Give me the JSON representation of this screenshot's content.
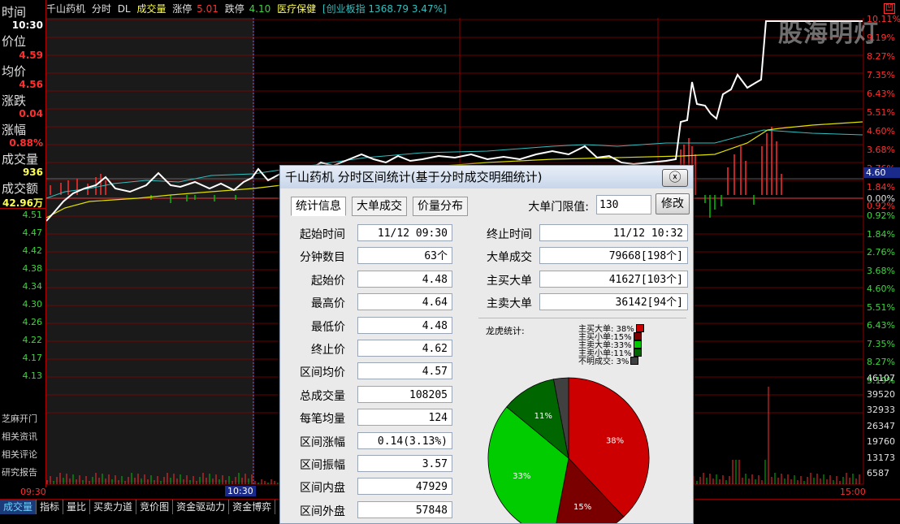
{
  "header": {
    "name": "千山药机",
    "mode": "分时",
    "dl": "DL",
    "vol": "成交量",
    "zt_label": "涨停",
    "zt_val": "5.01",
    "dt_label": "跌停",
    "dt_val": "4.10",
    "sector": "医疗保健",
    "index": "[创业板指 1368.79 3.47%]"
  },
  "watermark": "股海明灯",
  "corner_mark": "凹",
  "left_info": {
    "time_label": "时间",
    "time": "10:30",
    "price_label": "价位",
    "price": "4.59",
    "avg_label": "均价",
    "avg": "4.56",
    "chg_label": "涨跌",
    "chg": "0.04",
    "pct_label": "涨幅",
    "pct": "0.88%",
    "vol_label": "成交量",
    "vol": "936",
    "amt_label": "成交额",
    "amt": "42.96万"
  },
  "left_prices": [
    "4.51",
    "4.47",
    "4.42",
    "4.38",
    "4.34",
    "4.30",
    "4.26",
    "4.22",
    "4.17",
    "4.13"
  ],
  "left_links": [
    "芝麻开门",
    "相关资讯",
    "相关评论",
    "研究报告"
  ],
  "right_pct_up": [
    "10.11%",
    "9.19%",
    "8.27%",
    "7.35%",
    "6.43%",
    "5.51%",
    "4.60%",
    "3.68%",
    "2.76%",
    "1.84%",
    "0.92%"
  ],
  "right_zero": "0.00%",
  "right_cursor": "4.60",
  "right_pct_down": [
    "0.92%",
    "1.84%",
    "2.76%",
    "3.68%",
    "4.60%",
    "5.51%",
    "6.43%",
    "7.35%",
    "8.27%",
    "9.19%"
  ],
  "right_vol": [
    "46107",
    "39520",
    "32933",
    "26347",
    "19760",
    "13173",
    "6587"
  ],
  "time_axis": {
    "start": "09:30",
    "cursor": "10:30",
    "end": "15:00"
  },
  "bottom_tabs": [
    "成交量",
    "指标",
    "量比",
    "买卖力道",
    "竞价图",
    "资金驱动力",
    "资金博弈"
  ],
  "dialog": {
    "title": "千山药机 分时区间统计(基于分时成交明细统计)",
    "close": "ⓧ",
    "tabs": [
      "统计信息",
      "大单成交",
      "价量分布"
    ],
    "threshold_label": "大单门限值:",
    "threshold_value": "130",
    "modify_btn": "修改",
    "left_stats": [
      {
        "label": "起始时间",
        "value": "11/12 09:30"
      },
      {
        "label": "分钟数目",
        "value": "63个"
      },
      {
        "label": "起始价",
        "value": "4.48"
      },
      {
        "label": "最高价",
        "value": "4.64"
      },
      {
        "label": "最低价",
        "value": "4.48"
      },
      {
        "label": "终止价",
        "value": "4.62"
      },
      {
        "label": "区间均价",
        "value": "4.57"
      },
      {
        "label": "总成交量",
        "value": "108205"
      },
      {
        "label": "每笔均量",
        "value": "124"
      },
      {
        "label": "区间涨幅",
        "value": "0.14(3.13%)"
      },
      {
        "label": "区间振幅",
        "value": "3.57"
      },
      {
        "label": "区间内盘",
        "value": "47929"
      },
      {
        "label": "区间外盘",
        "value": "57848"
      }
    ],
    "right_stats": [
      {
        "label": "终止时间",
        "value": "11/12 10:32"
      },
      {
        "label": "大单成交",
        "value": "79668[198个]"
      },
      {
        "label": "主买大单",
        "value": "41627[103个]"
      },
      {
        "label": "主卖大单",
        "value": "36142[94个]"
      }
    ],
    "dragon_label": "龙虎统计:",
    "legend": [
      {
        "text": "主买大单: 38%",
        "color": "#cc0000"
      },
      {
        "text": "主买小单:15%",
        "color": "#7a0000"
      },
      {
        "text": "主卖大单:33%",
        "color": "#00cc00"
      },
      {
        "text": "主卖小单:11%",
        "color": "#006600"
      },
      {
        "text": "不明成交: 3%",
        "color": "#404040"
      }
    ],
    "pie": [
      {
        "name": "主买大单",
        "pct": 38,
        "label": "38%",
        "color": "#cc0000"
      },
      {
        "name": "主买小单",
        "pct": 15,
        "label": "15%",
        "color": "#7a0000"
      },
      {
        "name": "主卖大单",
        "pct": 33,
        "label": "33%",
        "color": "#00cc00"
      },
      {
        "name": "主卖小单",
        "pct": 11,
        "label": "11%",
        "color": "#006600"
      },
      {
        "name": "不明成交",
        "pct": 3,
        "label": "",
        "color": "#404040"
      }
    ]
  },
  "colors": {
    "up": "#ff3030",
    "down": "#00c000",
    "grid": "#8b0000",
    "avg": "#e0e000",
    "index": "#30c0c0",
    "price": "#ffffff"
  }
}
